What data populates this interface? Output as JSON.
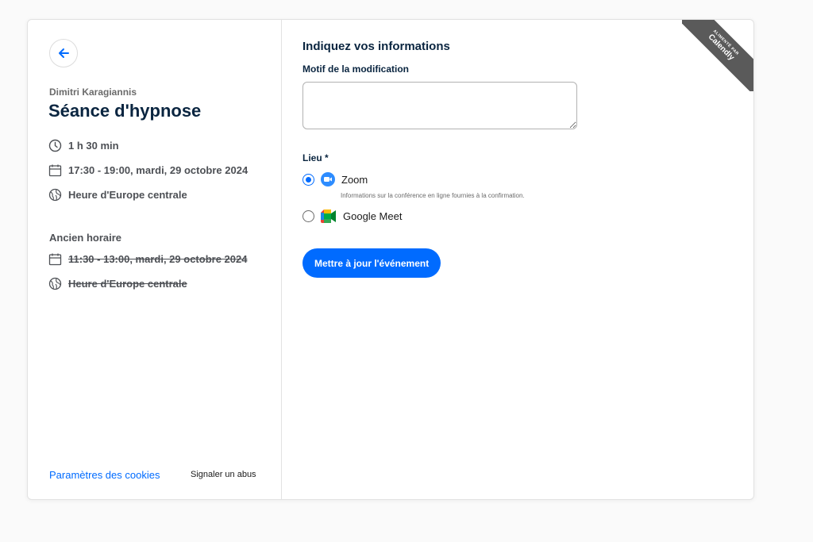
{
  "sidebar": {
    "host_name": "Dimitri Karagiannis",
    "event_title": "Séance d'hypnose",
    "duration": "1 h 30 min",
    "datetime": "17:30 - 19:00, mardi, 29 octobre 2024",
    "timezone": "Heure d'Europe centrale",
    "old_label": "Ancien horaire",
    "old_datetime": "11:30 - 13:00, mardi, 29 octobre 2024",
    "old_timezone": "Heure d'Europe centrale",
    "cookie_link": "Paramètres des cookies",
    "report_link": "Signaler un abus"
  },
  "form": {
    "heading": "Indiquez vos informations",
    "reason_label": "Motif de la modification",
    "reason_value": "",
    "location_label": "Lieu *",
    "options": [
      {
        "label": "Zoom",
        "selected": true,
        "hint": "Informations sur la conférence en ligne fournies à la confirmation."
      },
      {
        "label": "Google Meet",
        "selected": false
      }
    ],
    "submit_label": "Mettre à jour l'événement"
  },
  "ribbon": {
    "small": "ALIMENTÉ PAR",
    "brand": "Calendly"
  },
  "colors": {
    "accent": "#006bff",
    "title": "#0a2540",
    "ribbon": "#5a5a5a"
  },
  "icons": {
    "back": "arrow-left-icon",
    "duration": "clock-icon",
    "date": "calendar-icon",
    "timezone": "globe-icon",
    "zoom": "zoom-icon",
    "meet": "google-meet-icon"
  }
}
